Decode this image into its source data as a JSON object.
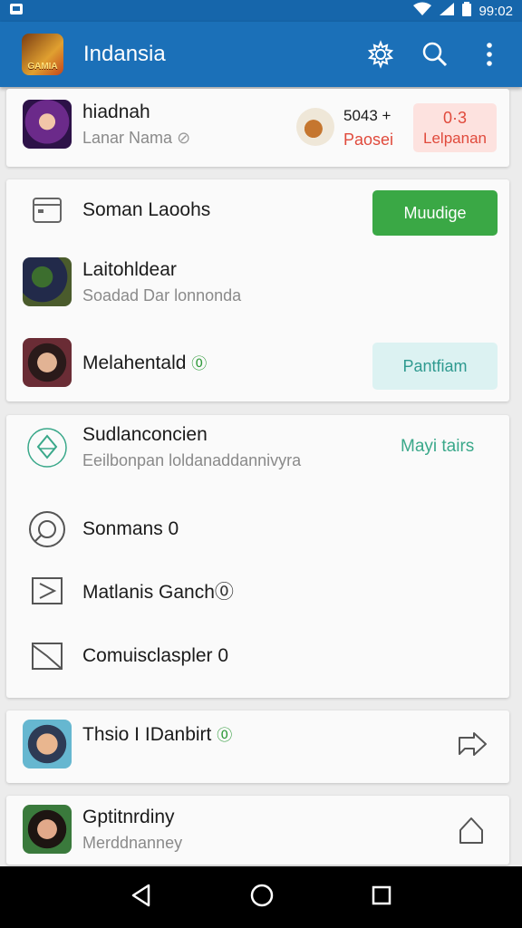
{
  "status_bar": {
    "time": "99:02"
  },
  "app_bar": {
    "title": "Indansia",
    "logo_text": "GAMIA",
    "icons": [
      "settings-gear-icon",
      "search-icon",
      "more-vert-icon"
    ]
  },
  "profile_card": {
    "name": "hiadnah",
    "subtitle": "Lanar Nama",
    "stat_value": "5043 +",
    "stat_label": "Paosei",
    "badge_value": "0·3",
    "badge_label": "Lelpanan"
  },
  "list_card_1": {
    "row1": {
      "label": "Soman Laoohs",
      "button": "Muudige"
    },
    "row2": {
      "title": "Laitohldear",
      "subtitle": "Soadad Dar lonnonda"
    },
    "row3": {
      "title": "Melahentald",
      "button": "Pantfiam"
    }
  },
  "settings_card": {
    "row1": {
      "title": "Sudlanconcien",
      "subtitle": "Eeilbonpan loldanaddannivyra",
      "action": "Mayi tairs"
    },
    "row2": {
      "title": "Sonmans 0"
    },
    "row3": {
      "title": "Matlanis Ganch"
    },
    "row4": {
      "title": "Comuisclaspler 0"
    }
  },
  "share_card": {
    "title": "Thsio I IDanbirt"
  },
  "last_card": {
    "title": "Gptitnrdiny",
    "subtitle": "Merddnanney"
  },
  "colors": {
    "app_bar": "#1b70b8",
    "primary_button": "#3aa845",
    "secondary_button": "#dcf2f2",
    "badge_bg": "#fde2df",
    "badge_text": "#e04a3c",
    "accent_green": "#2f9a3a"
  },
  "nav_bar": {
    "icons": [
      "back-icon",
      "home-icon",
      "recents-icon"
    ]
  }
}
